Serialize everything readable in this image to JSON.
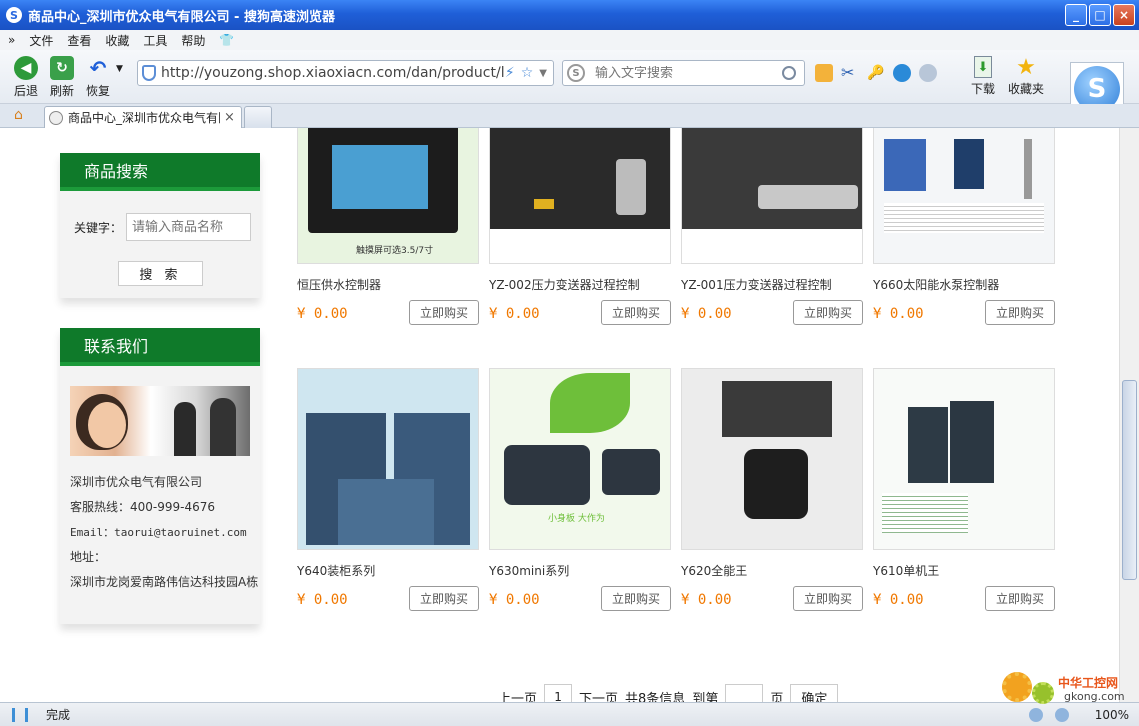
{
  "window": {
    "title": "商品中心_深圳市优众电气有限公司 - 搜狗高速浏览器",
    "app_icon_letter": "S"
  },
  "menu": {
    "chevron": "»",
    "items": [
      "文件",
      "查看",
      "收藏",
      "工具",
      "帮助"
    ]
  },
  "toolbar": {
    "back_label": "后退",
    "refresh_label": "刷新",
    "restore_label": "恢复",
    "url": "http://youzong.shop.xiaoxiacn.com/dan/product/list",
    "search_placeholder": "输入文字搜索",
    "download_label": "下载",
    "favorites_label": "收藏夹",
    "logo_letter": "S"
  },
  "tab": {
    "label": "商品中心_深圳市优众电气有限公司",
    "close": "×"
  },
  "sidebar": {
    "search": {
      "title": "商品搜索",
      "keyword_label": "关键字：",
      "keyword_placeholder": "请输入商品名称",
      "button_label": "搜 索"
    },
    "contact": {
      "title": "联系我们",
      "company": "深圳市优众电气有限公司",
      "hotline": "客服热线：400-999-4676",
      "email": "Email：taorui@taoruinet.com",
      "address_label": "地址：",
      "address": "深圳市龙岗爱南路伟信达科技园A栋"
    }
  },
  "products": [
    {
      "name": "恒压供水控制器",
      "price": "¥ 0.00",
      "buy": "立即购买",
      "img_text": "触摸屏可选3.5/7寸"
    },
    {
      "name": "YZ-002压力变送器过程控制",
      "price": "¥ 0.00",
      "buy": "立即购买"
    },
    {
      "name": "YZ-001压力变送器过程控制",
      "price": "¥ 0.00",
      "buy": "立即购买"
    },
    {
      "name": "Y660太阳能水泵控制器",
      "price": "¥ 0.00",
      "buy": "立即购买"
    },
    {
      "name": "Y640装柜系列",
      "price": "¥ 0.00",
      "buy": "立即购买"
    },
    {
      "name": "Y630mini系列",
      "price": "¥ 0.00",
      "buy": "立即购买",
      "img_text": "小身板 大作为"
    },
    {
      "name": "Y620全能王",
      "price": "¥ 0.00",
      "buy": "立即购买"
    },
    {
      "name": "Y610单机王",
      "price": "¥ 0.00",
      "buy": "立即购买"
    }
  ],
  "pager": {
    "prev": "上一页",
    "current": "1",
    "next": "下一页",
    "total": "共8条信息",
    "goto": "到第",
    "page_unit": "页",
    "confirm": "确定"
  },
  "status": {
    "text": "完成",
    "zoom": "100%"
  },
  "watermark": {
    "line1": "中华工控网",
    "line2": "gkong.com"
  },
  "colors": {
    "accent_green": "#0f7a2a",
    "price_orange": "#f07800",
    "title_blue": "#1f5fd8"
  }
}
